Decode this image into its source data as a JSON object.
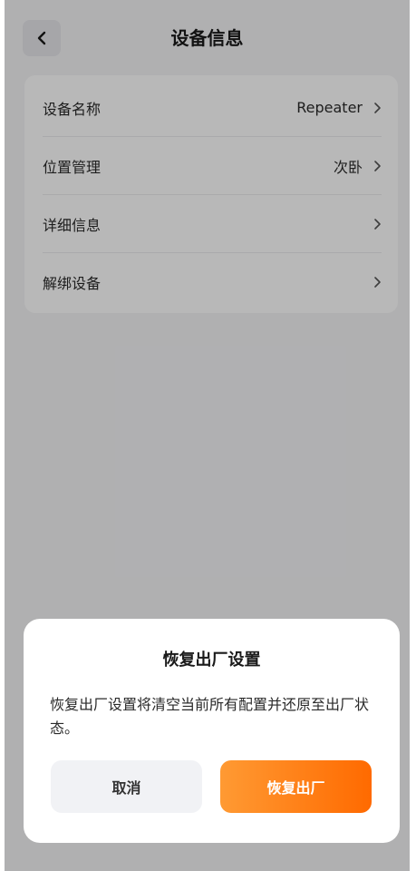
{
  "header": {
    "title": "设备信息"
  },
  "settings": {
    "rows": [
      {
        "label": "设备名称",
        "value": "Repeater"
      },
      {
        "label": "位置管理",
        "value": "次卧"
      },
      {
        "label": "详细信息",
        "value": ""
      },
      {
        "label": "解绑设备",
        "value": ""
      }
    ]
  },
  "dialog": {
    "title": "恢复出厂设置",
    "message": "恢复出厂设置将清空当前所有配置并还原至出厂状态。",
    "cancel_label": "取消",
    "confirm_label": "恢复出厂"
  },
  "colors": {
    "accent_start": "#ff9a33",
    "accent_end": "#ff6a00"
  }
}
